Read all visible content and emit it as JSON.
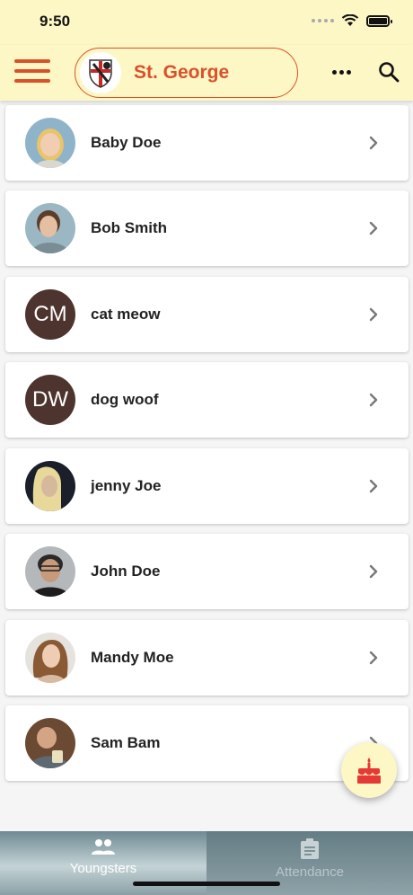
{
  "status_bar": {
    "time": "9:50"
  },
  "app_bar": {
    "school_name": "St. George",
    "colors": {
      "accent": "#d9502a",
      "bar_background": "#fdf7c6"
    }
  },
  "youngsters": [
    {
      "name": "Baby Doe",
      "initials": "",
      "avatar": "photo"
    },
    {
      "name": "Bob Smith",
      "initials": "",
      "avatar": "photo"
    },
    {
      "name": "cat meow",
      "initials": "CM",
      "avatar": "initials"
    },
    {
      "name": "dog woof",
      "initials": "DW",
      "avatar": "initials"
    },
    {
      "name": "jenny Joe",
      "initials": "",
      "avatar": "photo"
    },
    {
      "name": "John Doe",
      "initials": "",
      "avatar": "photo"
    },
    {
      "name": "Mandy Moe",
      "initials": "",
      "avatar": "photo"
    },
    {
      "name": "Sam Bam",
      "initials": "",
      "avatar": "photo"
    }
  ],
  "fab": {
    "icon": "birthday-cake-icon"
  },
  "tabs": [
    {
      "label": "Youngsters",
      "icon": "people-icon",
      "active": true
    },
    {
      "label": "Attendance",
      "icon": "clipboard-icon",
      "active": false
    }
  ]
}
